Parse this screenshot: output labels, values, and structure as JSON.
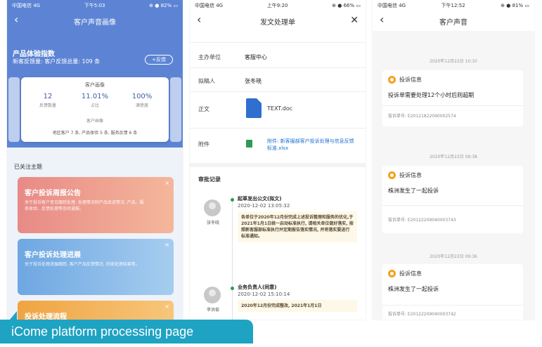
{
  "phone1": {
    "status": {
      "left": "中国电信 4G",
      "time": "下午5:03",
      "right": "⊕ ● 82% ▭"
    },
    "title": "客户声音画像",
    "metric_title": "产品体验指数",
    "metric_sub": "新客反馈量: 客户反馈总量: 109 条",
    "pill": "+反馈",
    "card": {
      "title": "客户画像",
      "stats": [
        {
          "value": "12",
          "label": "反馈数量"
        },
        {
          "value": "11.01%",
          "label": "占比"
        },
        {
          "value": "100%",
          "label": "满意度"
        }
      ],
      "link": "客户画像",
      "footer": "地区客户 7 条, 产品体验 5 条, 服务反馈 6 条"
    },
    "section": "已关注主题",
    "topics": [
      {
        "title": "客户投诉周报公告",
        "desc": "关于投诉客户意见跟踪处理, 处理情况和产品改进情况, 产品、服务体验、反馈处理等及时通报。",
        "close": "×",
        "color": "#ea8d82"
      },
      {
        "title": "客户投诉处理进展",
        "desc": "关于投诉处理进展跟踪, 客户产品反馈情况, 后续处理结果等。",
        "close": "×",
        "color": "#7fb3e6"
      },
      {
        "title": "投诉处理流程",
        "desc": "",
        "close": "×",
        "color": "#f2a94c"
      }
    ]
  },
  "phone2": {
    "status": {
      "left": "中国电信 4G",
      "time": "上午9:20",
      "right": "⊕ ● 66% ▭"
    },
    "title": "发文处理单",
    "fields": [
      {
        "key": "主办单位",
        "value": "客服中心"
      },
      {
        "key": "拟稿人",
        "value": "张冬晓"
      },
      {
        "key": "正文",
        "value": "TEXT.doc"
      },
      {
        "key": "附件",
        "value": "附件: 新客服部客户投诉处理与信息反馈标准.xlsx"
      }
    ],
    "section": "审批记录",
    "logs": [
      {
        "name": "张冬晓",
        "head": "起草发出公文(拟文)",
        "time": "2020-12-02 13:05:32",
        "body": "各单位于2020年12月份完成上述投诉整理和服务的优化,于2021年1月1日统一启动标准执行, 请相关单位做好落实, 按照新客服部标准执行并定期报告落实情况, 并将落实要进行标准通知。"
      },
      {
        "name": "李洪俊",
        "head": "业务负责人(同意)",
        "time": "2020-12-02 15:10:14",
        "body": "2020年12月份完成整改, 2021年1月1日"
      }
    ]
  },
  "phone3": {
    "status": {
      "left": "中国电信 4G",
      "time": "下午12:52",
      "right": "⊕ ● 81% ▭"
    },
    "title": "客户声音",
    "messages": [
      {
        "time": "2020年12月22日 10:10",
        "label": "投诉信息",
        "body": "投诉单需要处理12个小时后则超期",
        "num": "投诉单号: E20121822090002574"
      },
      {
        "time": "2020年12月22日 09:38",
        "label": "投诉信息",
        "body": "株洲发生了一起投诉",
        "num": "投诉单号: E20122209040003743"
      },
      {
        "time": "2020年12月22日 09:36",
        "label": "投诉信息",
        "body": "株洲发生了一起投诉",
        "num": "投诉单号: E20122209040003742"
      }
    ]
  },
  "banner": "iCome platform processing page"
}
